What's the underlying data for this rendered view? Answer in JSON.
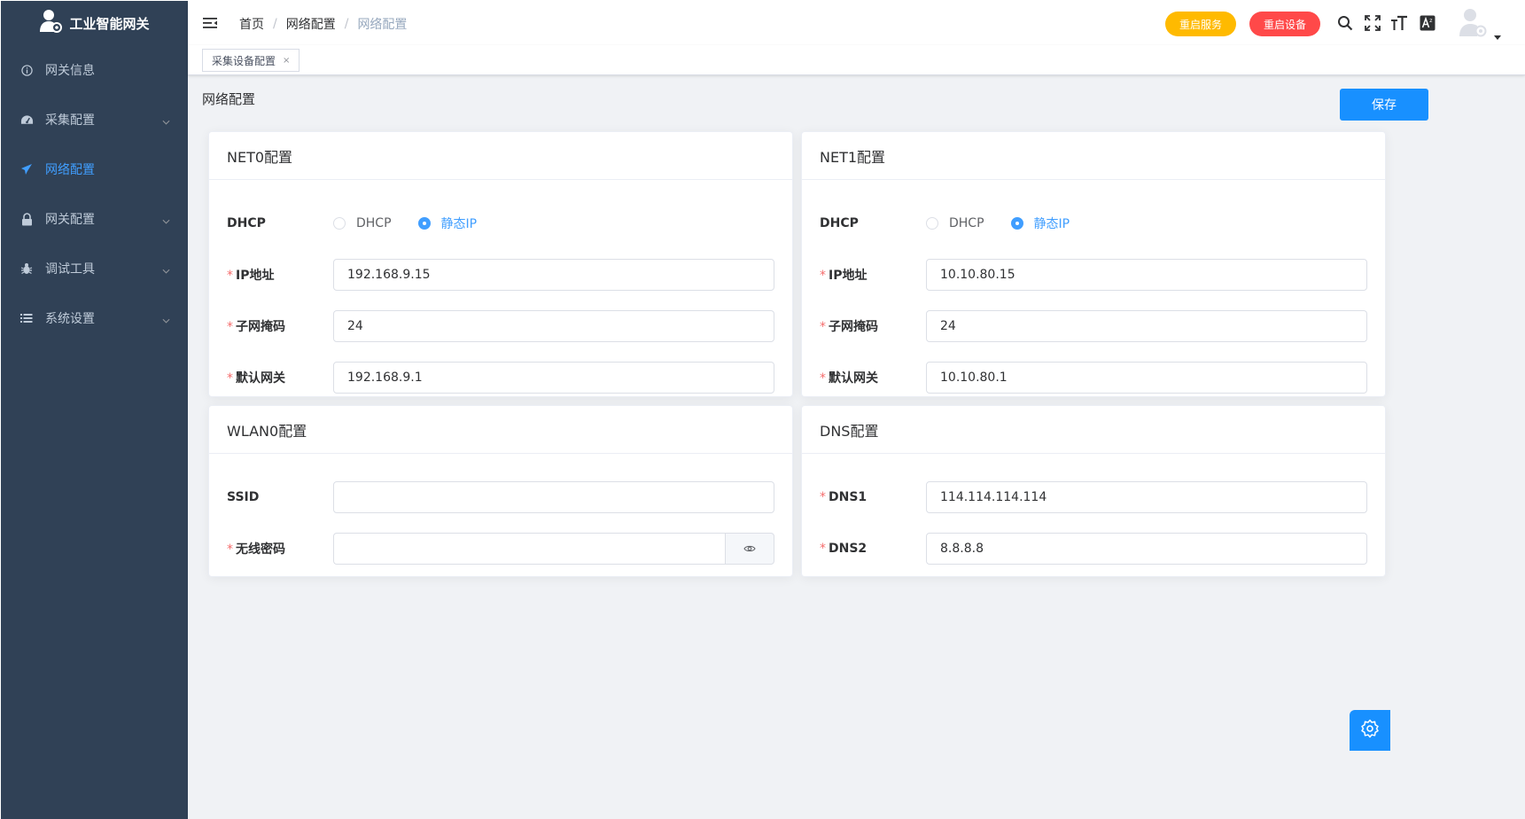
{
  "app": {
    "title": "工业智能网关"
  },
  "sidebar": {
    "items": [
      {
        "label": "网关信息",
        "icon": "info-icon",
        "active": false,
        "expandable": false
      },
      {
        "label": "采集配置",
        "icon": "dashboard-icon",
        "active": false,
        "expandable": true
      },
      {
        "label": "网络配置",
        "icon": "paper-plane-icon",
        "active": true,
        "expandable": false
      },
      {
        "label": "网关配置",
        "icon": "lock-icon",
        "active": false,
        "expandable": true
      },
      {
        "label": "调试工具",
        "icon": "bug-icon",
        "active": false,
        "expandable": true
      },
      {
        "label": "系统设置",
        "icon": "list-icon",
        "active": false,
        "expandable": true
      }
    ]
  },
  "header": {
    "breadcrumb": [
      "首页",
      "网络配置",
      "网络配置"
    ],
    "restart_service_label": "重启服务",
    "restart_device_label": "重启设备"
  },
  "tags": {
    "active_tag": "采集设备配置",
    "close": "×"
  },
  "page": {
    "title": "网络配置",
    "save_label": "保存"
  },
  "net0": {
    "title": "NET0配置",
    "dhcp_label": "DHCP",
    "mode_options": [
      "DHCP",
      "静态IP"
    ],
    "mode_selected": "静态IP",
    "ip_label": "IP地址",
    "ip_value": "192.168.9.15",
    "mask_label": "子网掩码",
    "mask_value": "24",
    "gateway_label": "默认网关",
    "gateway_value": "192.168.9.1"
  },
  "net1": {
    "title": "NET1配置",
    "dhcp_label": "DHCP",
    "mode_options": [
      "DHCP",
      "静态IP"
    ],
    "mode_selected": "静态IP",
    "ip_label": "IP地址",
    "ip_value": "10.10.80.15",
    "mask_label": "子网掩码",
    "mask_value": "24",
    "gateway_label": "默认网关",
    "gateway_value": "10.10.80.1"
  },
  "wlan0": {
    "title": "WLAN0配置",
    "ssid_label": "SSID",
    "ssid_value": "",
    "password_label": "无线密码",
    "password_value": ""
  },
  "dns": {
    "title": "DNS配置",
    "dns1_label": "DNS1",
    "dns1_value": "114.114.114.114",
    "dns2_label": "DNS2",
    "dns2_value": "8.8.8.8"
  },
  "colors": {
    "sidebar_bg": "#304156",
    "accent": "#409eff",
    "primary_button": "#1890ff",
    "warning": "#ffba00",
    "danger": "#ff4949"
  }
}
